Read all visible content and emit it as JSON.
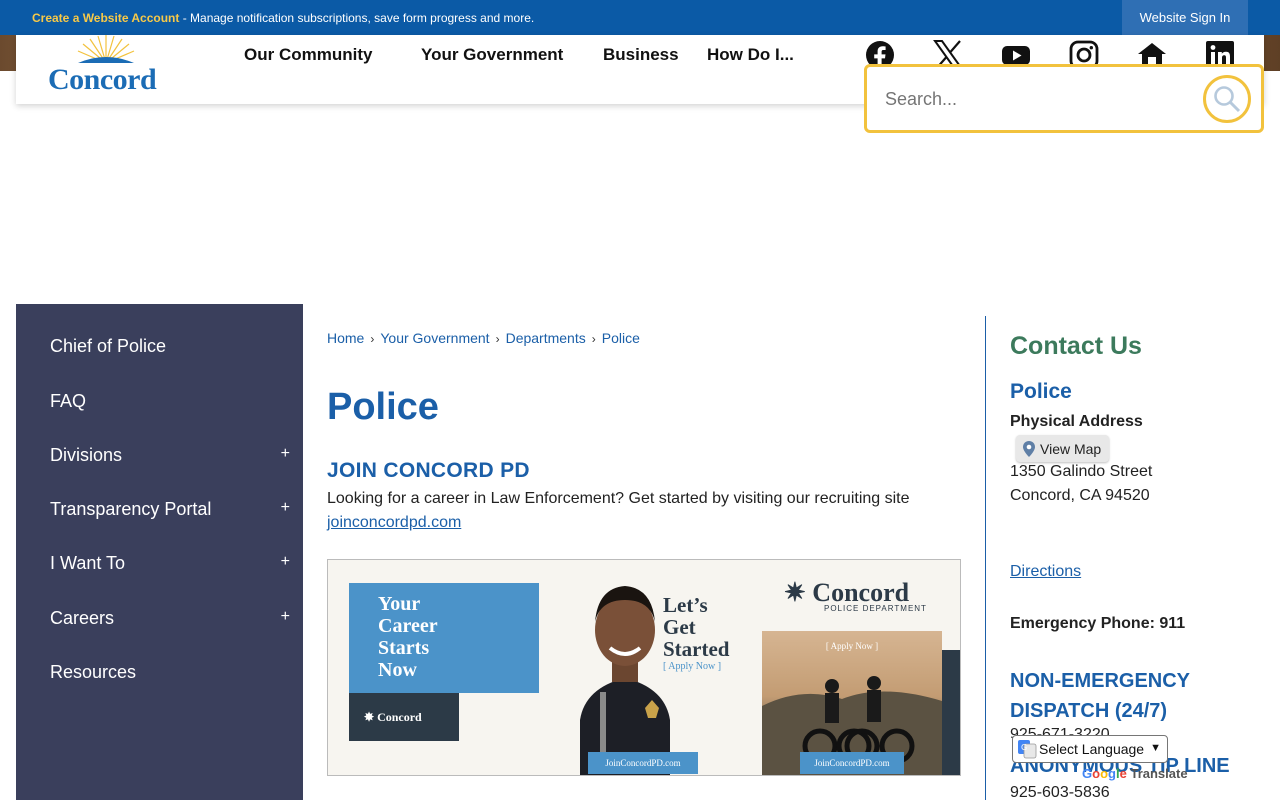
{
  "topbar": {
    "account_link": "Create a Website Account",
    "account_message": " - Manage notification subscriptions, save form progress and more.",
    "signin_label": "Website Sign In"
  },
  "header": {
    "logo_text": "Concord",
    "nav": [
      "Our Community",
      "Your Government",
      "Business",
      "How Do I..."
    ],
    "social": [
      "facebook-icon",
      "x-icon",
      "youtube-icon",
      "instagram-icon",
      "nextdoor-icon",
      "linkedin-icon"
    ]
  },
  "search": {
    "placeholder": "Search..."
  },
  "sidebar": {
    "items": [
      {
        "label": "Chief of Police",
        "expandable": false
      },
      {
        "label": "FAQ",
        "expandable": false
      },
      {
        "label": "Divisions",
        "expandable": true
      },
      {
        "label": "Transparency Portal",
        "expandable": true
      },
      {
        "label": "I Want To",
        "expandable": true
      },
      {
        "label": "Careers",
        "expandable": true
      },
      {
        "label": "Resources",
        "expandable": false
      }
    ],
    "expand_symbol": "+"
  },
  "breadcrumb": [
    "Home",
    "Your Government",
    "Departments",
    "Police"
  ],
  "breadcrumb_sep": "›",
  "main": {
    "title": "Police",
    "section_title": "JOIN CONCORD PD",
    "section_text": "Looking for a career in Law Enforcement? Get started by visiting our recruiting site",
    "section_link": "joinconcordpd.com"
  },
  "recruit_banner": {
    "line1": "Your",
    "line2": "Career",
    "line3": "Starts",
    "line4": "Now",
    "lets1": "Let’s",
    "lets2": "Get",
    "lets3": "Started",
    "apply": "[ Apply Now ]",
    "brand": "Concord",
    "brand_sub": "POLICE DEPARTMENT",
    "small_logo": "Concord",
    "site": "JoinConcordPD.com"
  },
  "contact": {
    "title": "Contact Us",
    "department": "Police",
    "address_label": "Physical Address",
    "view_map": "View Map",
    "street": "1350 Galindo Street",
    "city": "Concord, CA 94520",
    "directions": "Directions",
    "emergency": "Emergency Phone: 911",
    "non_emergency": "NON-EMERGENCY DISPATCH (24/7)",
    "non_emergency_phone": "925-671-3220",
    "tip_line": "ANONYMOUS TIP LINE",
    "tip_phone": "925-603-5836"
  },
  "translate": {
    "select_label": "Select Language",
    "powered": "Translate"
  },
  "colors": {
    "topbar": "#0b5aa6",
    "accent_yellow": "#f2c23d",
    "sidebar": "#3a3f5c",
    "link_blue": "#1b5fa8",
    "contact_green": "#3c7a5c"
  }
}
